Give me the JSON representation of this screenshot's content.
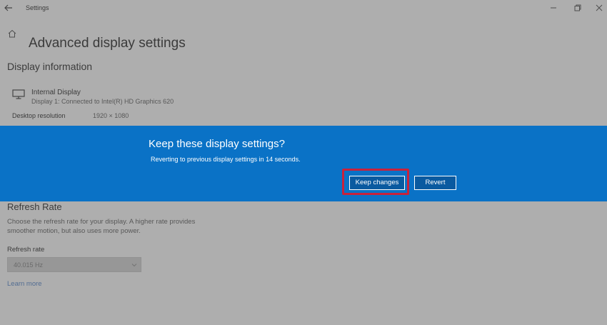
{
  "window": {
    "title": "Settings",
    "back_icon": "back-arrow-icon",
    "controls": [
      "minimize-icon",
      "maximize-icon",
      "close-icon"
    ]
  },
  "page": {
    "title": "Advanced display settings"
  },
  "display_info": {
    "section_title": "Display information",
    "display_name": "Internal Display",
    "display_detail": "Display 1: Connected to Intel(R) HD Graphics 620",
    "resolution_label": "Desktop resolution",
    "resolution_value": "1920 × 1080"
  },
  "refresh_rate": {
    "section_title": "Refresh Rate",
    "description": "Choose the refresh rate for your display. A higher rate provides smoother motion, but also uses more power.",
    "field_label": "Refresh rate",
    "selected_value": "40.015 Hz",
    "learn_more": "Learn more"
  },
  "dialog": {
    "title": "Keep these display settings?",
    "message": "Reverting to previous display settings in 14 seconds.",
    "keep_label": "Keep changes",
    "revert_label": "Revert"
  },
  "colors": {
    "banner": "#0a72c6",
    "highlight": "#c8223c"
  }
}
